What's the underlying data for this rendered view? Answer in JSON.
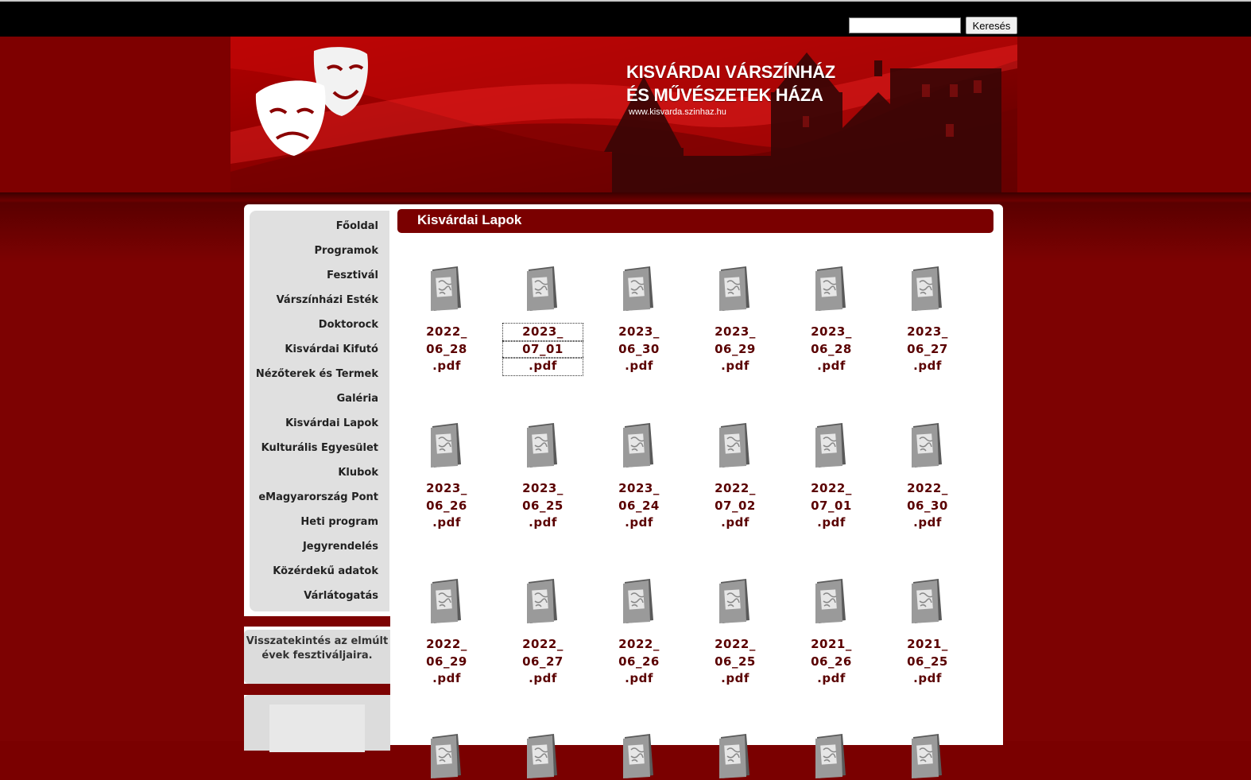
{
  "search": {
    "placeholder": "",
    "value": "",
    "button_label": "Keresés"
  },
  "header": {
    "title_line1": "KISVÁRDAI VÁRSZÍNHÁZ",
    "title_line2": "ÉS MŰVÉSZETEK HÁZA",
    "url": "www.kisvarda.szinhaz.hu"
  },
  "nav": {
    "items": [
      {
        "label": "Főoldal"
      },
      {
        "label": "Programok"
      },
      {
        "label": "Fesztivál"
      },
      {
        "label": "Várszínházi Esték"
      },
      {
        "label": "Doktorock"
      },
      {
        "label": "Kisvárdai Kifutó"
      },
      {
        "label": "Nézőterek és Termek"
      },
      {
        "label": "Galéria"
      },
      {
        "label": "Kisvárdai Lapok"
      },
      {
        "label": "Kulturális Egyesület"
      },
      {
        "label": "Klubok"
      },
      {
        "label": "eMagyarország Pont"
      },
      {
        "label": "Heti program"
      },
      {
        "label": "Jegyrendelés"
      },
      {
        "label": "Közérdekű adatok"
      },
      {
        "label": "Várlátogatás"
      }
    ]
  },
  "sidebar_box": {
    "line1": "Visszatekintés az elmúlt",
    "line2": "évek fesztiváljaira."
  },
  "page": {
    "title": "Kisvárdai Lapok"
  },
  "files": [
    {
      "a": "2022_",
      "b": "06_28",
      "c": ".pdf"
    },
    {
      "a": "2023_",
      "b": "07_01",
      "c": ".pdf",
      "focused": true
    },
    {
      "a": "2023_",
      "b": "06_30",
      "c": ".pdf"
    },
    {
      "a": "2023_",
      "b": "06_29",
      "c": ".pdf"
    },
    {
      "a": "2023_",
      "b": "06_28",
      "c": ".pdf"
    },
    {
      "a": "2023_",
      "b": "06_27",
      "c": ".pdf"
    },
    {
      "a": "2023_",
      "b": "06_26",
      "c": ".pdf"
    },
    {
      "a": "2023_",
      "b": "06_25",
      "c": ".pdf"
    },
    {
      "a": "2023_",
      "b": "06_24",
      "c": ".pdf"
    },
    {
      "a": "2022_",
      "b": "07_02",
      "c": ".pdf"
    },
    {
      "a": "2022_",
      "b": "07_01",
      "c": ".pdf"
    },
    {
      "a": "2022_",
      "b": "06_30",
      "c": ".pdf"
    },
    {
      "a": "2022_",
      "b": "06_29",
      "c": ".pdf"
    },
    {
      "a": "2022_",
      "b": "06_27",
      "c": ".pdf"
    },
    {
      "a": "2022_",
      "b": "06_26",
      "c": ".pdf"
    },
    {
      "a": "2022_",
      "b": "06_25",
      "c": ".pdf"
    },
    {
      "a": "2021_",
      "b": "06_26",
      "c": ".pdf"
    },
    {
      "a": "2021_",
      "b": "06_25",
      "c": ".pdf"
    }
  ],
  "colors": {
    "brand_red": "#7a0000",
    "link": "#5a0000",
    "nav_bg": "#e0e0e0"
  },
  "icons": {
    "file_icon": "file-document-icon",
    "logo": "theatre-masks-icon"
  }
}
